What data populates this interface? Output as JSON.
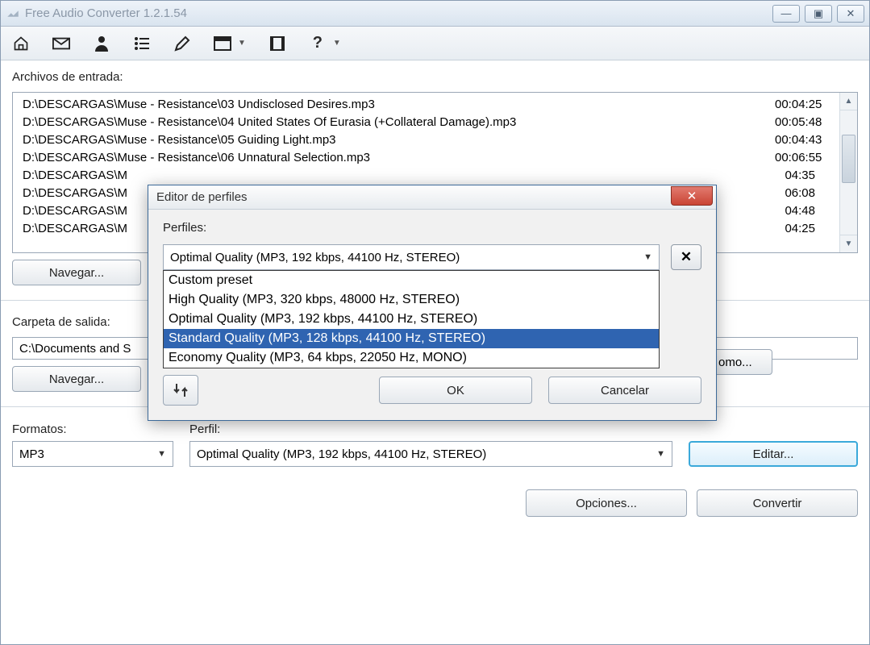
{
  "window": {
    "title": "Free Audio Converter 1.2.1.54"
  },
  "labels": {
    "input_files": "Archivos de entrada:",
    "browse": "Navegar...",
    "output_folder": "Carpeta de salida:",
    "formats": "Formatos:",
    "profile": "Perfil:",
    "edit": "Editar...",
    "options": "Opciones...",
    "convert": "Convertir",
    "peek_como": "omo..."
  },
  "files": [
    {
      "path": "D:\\DESCARGAS\\Muse - Resistance\\03 Undisclosed Desires.mp3",
      "duration": "00:04:25"
    },
    {
      "path": "D:\\DESCARGAS\\Muse - Resistance\\04 United States Of Eurasia (+Collateral Damage).mp3",
      "duration": "00:05:48"
    },
    {
      "path": "D:\\DESCARGAS\\Muse - Resistance\\05 Guiding Light.mp3",
      "duration": "00:04:43"
    },
    {
      "path": "D:\\DESCARGAS\\Muse - Resistance\\06 Unnatural Selection.mp3",
      "duration": "00:06:55"
    },
    {
      "path": "D:\\DESCARGAS\\M",
      "duration": "04:35"
    },
    {
      "path": "D:\\DESCARGAS\\M",
      "duration": "06:08"
    },
    {
      "path": "D:\\DESCARGAS\\M",
      "duration": "04:48"
    },
    {
      "path": "D:\\DESCARGAS\\M",
      "duration": "04:25"
    }
  ],
  "output_path": "C:\\Documents and S",
  "format_selected": "MP3",
  "profile_selected": "Optimal Quality (MP3, 192 kbps, 44100 Hz, STEREO)",
  "dialog": {
    "title": "Editor de perfiles",
    "profiles_label": "Perfiles:",
    "selected": "Optimal Quality (MP3, 192 kbps, 44100 Hz, STEREO)",
    "options": [
      "Custom preset",
      "High Quality (MP3, 320 kbps, 48000 Hz, STEREO)",
      "Optimal Quality (MP3, 192 kbps, 44100 Hz, STEREO)",
      "Standard Quality (MP3, 128 kbps, 44100 Hz, STEREO)",
      "Economy Quality (MP3, 64 kbps, 22050 Hz, MONO)"
    ],
    "highlighted_index": 3,
    "ok": "OK",
    "cancel": "Cancelar"
  }
}
